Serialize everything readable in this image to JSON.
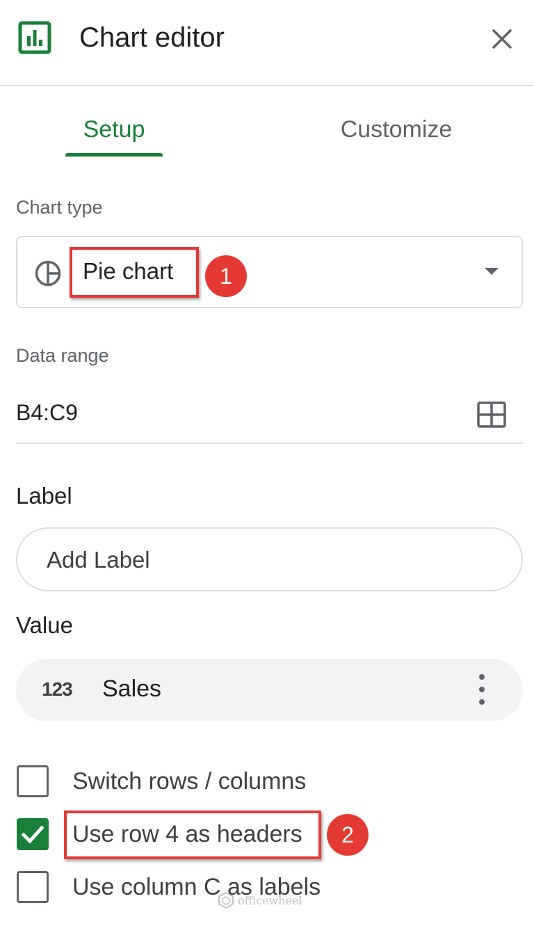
{
  "header": {
    "title": "Chart editor",
    "logo_icon": "chart-bar-icon",
    "close_icon": "close-icon"
  },
  "tabs": [
    {
      "label": "Setup",
      "active": true
    },
    {
      "label": "Customize",
      "active": false
    }
  ],
  "chart_type": {
    "section_label": "Chart type",
    "value": "Pie chart",
    "icon": "pie-chart-icon"
  },
  "data_range": {
    "section_label": "Data range",
    "value": "B4:C9",
    "icon": "grid-select-icon"
  },
  "label_section": {
    "title": "Label",
    "placeholder": "Add Label"
  },
  "value_section": {
    "title": "Value",
    "type_icon_text": "123",
    "field": "Sales"
  },
  "options": [
    {
      "label": "Switch rows / columns",
      "checked": false
    },
    {
      "label": "Use row 4 as headers",
      "checked": true
    },
    {
      "label": "Use column C as labels",
      "checked": false
    }
  ],
  "annotations": {
    "badge1": "1",
    "badge2": "2"
  },
  "watermark": "officewheel",
  "colors": {
    "accent_green": "#188038",
    "annotation_red": "#e53935",
    "border_gray": "#dadce0"
  }
}
